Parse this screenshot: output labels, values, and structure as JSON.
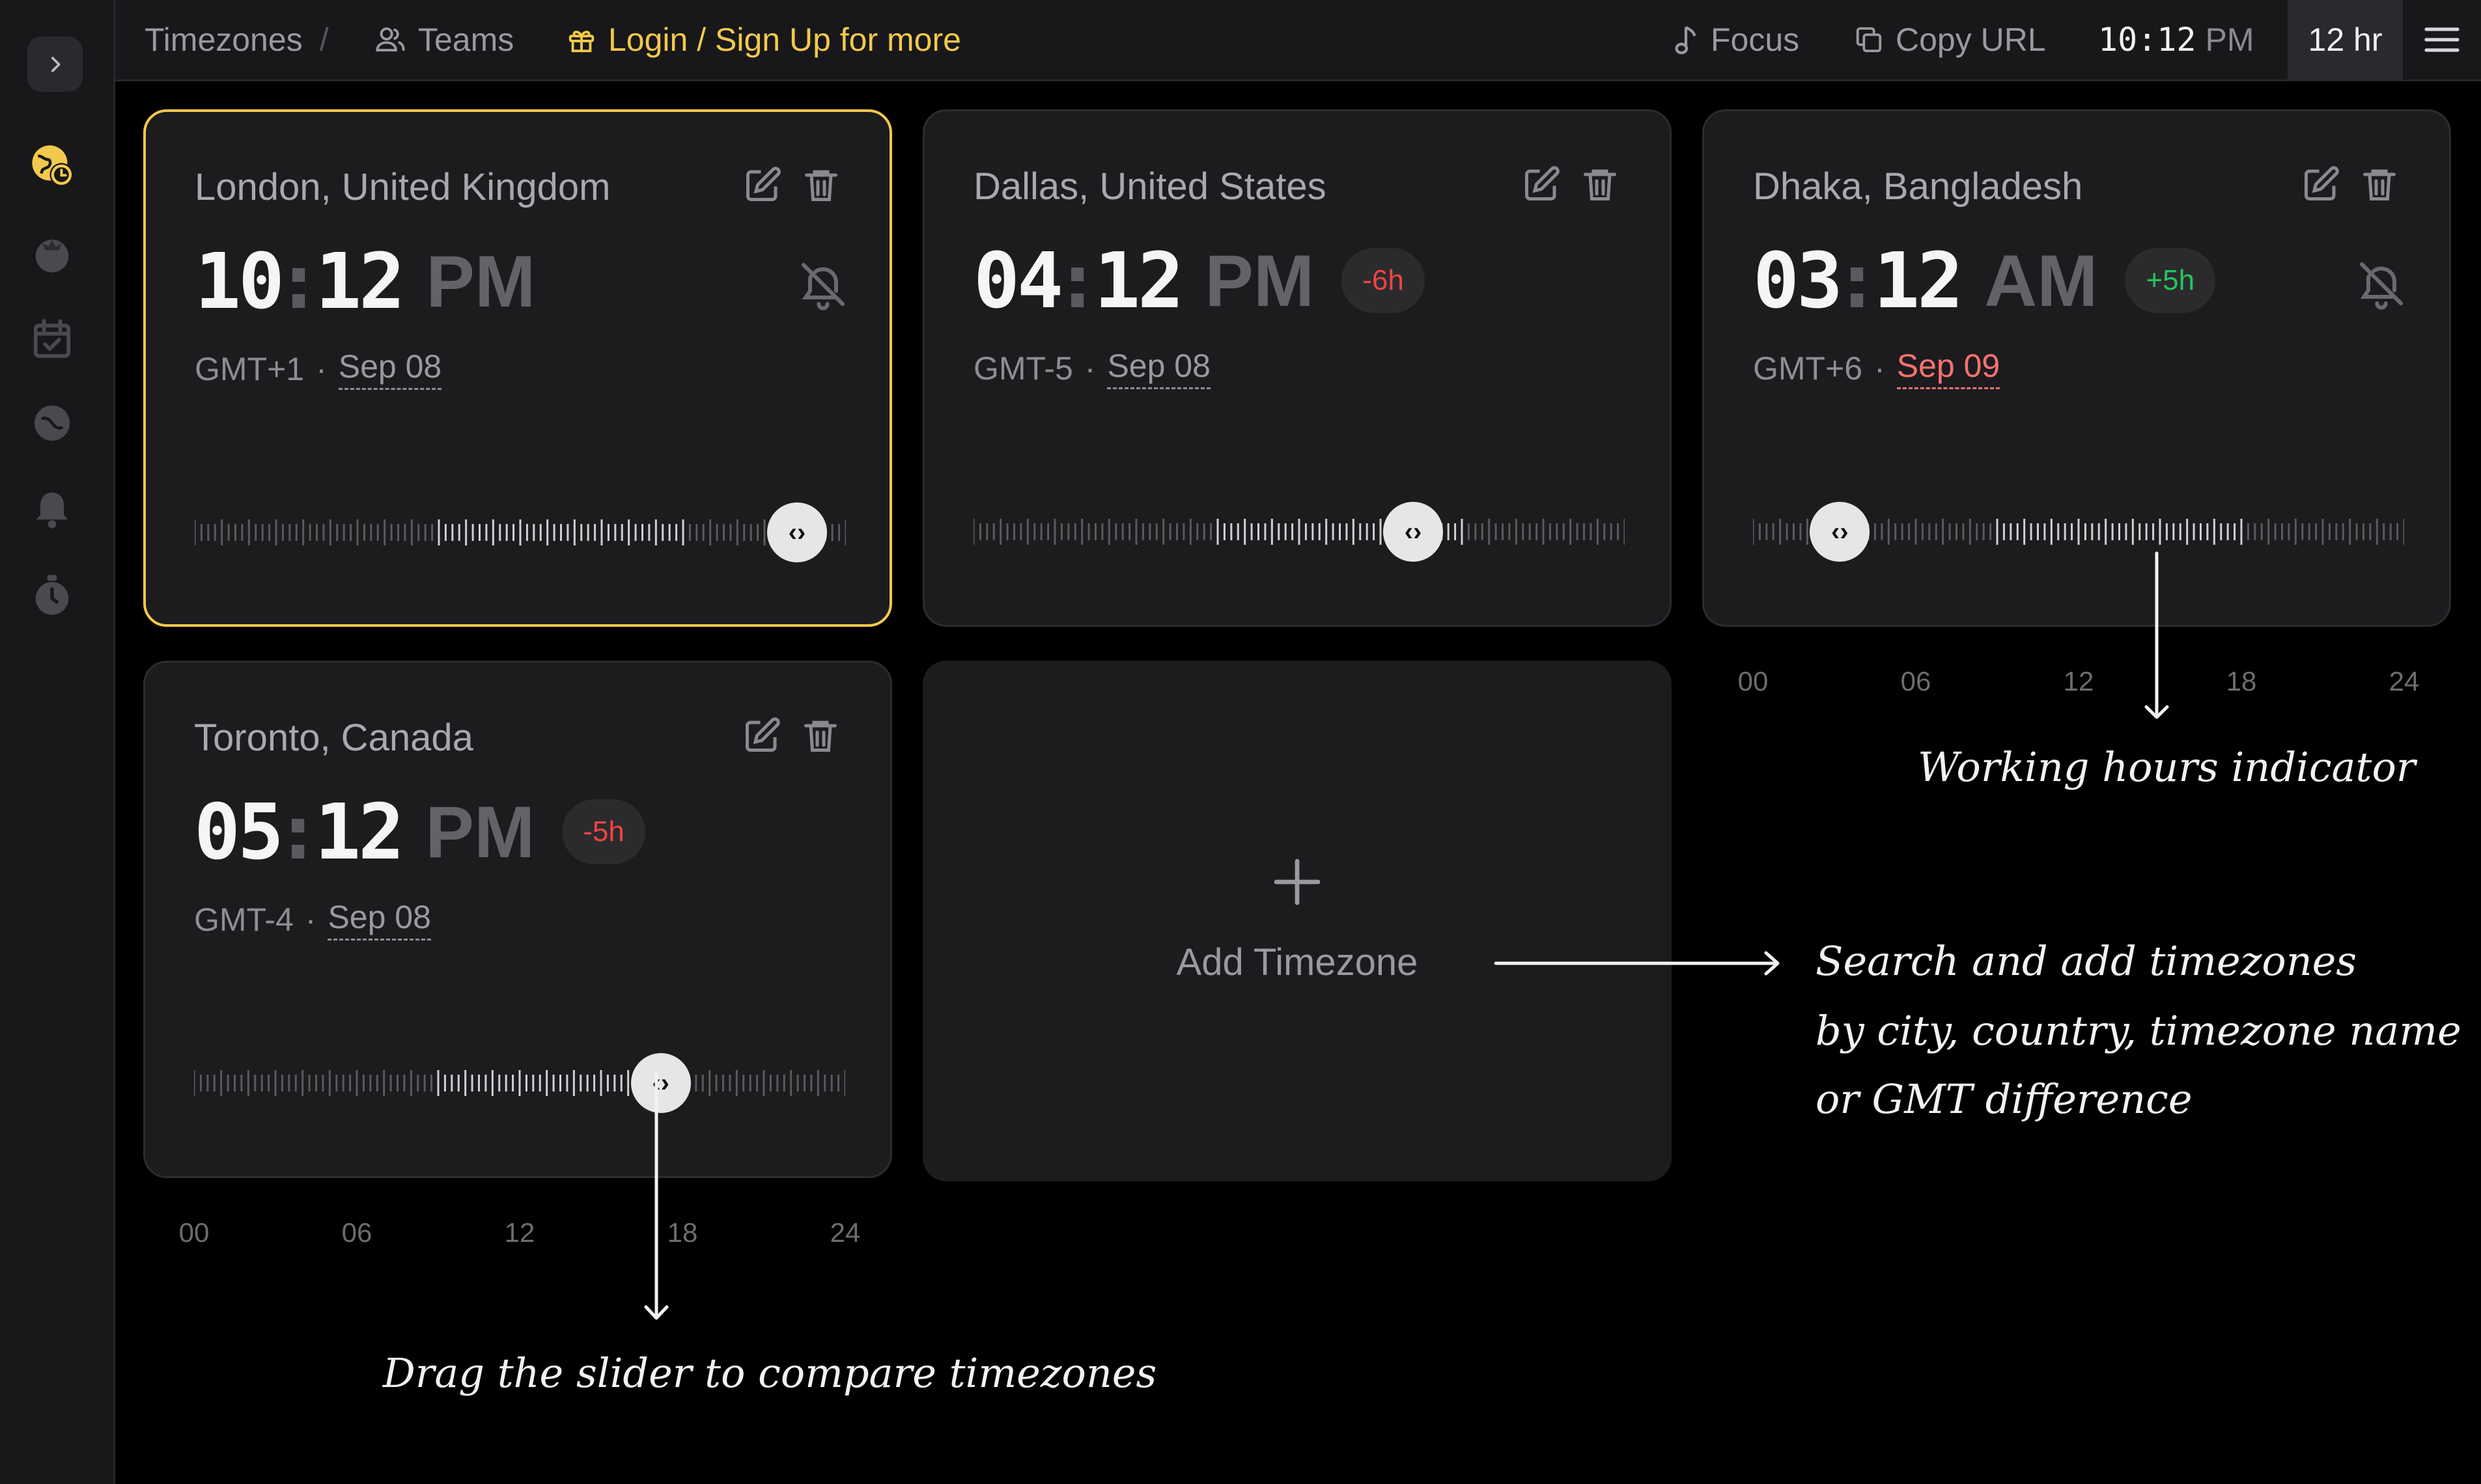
{
  "topbar": {
    "breadcrumb_root": "Timezones",
    "breadcrumb_sep": "/",
    "teams_label": "Teams",
    "login_label": "Login / Sign Up for more",
    "focus_label": "Focus",
    "copy_url_label": "Copy URL",
    "current_time": "10:12",
    "current_ampm": "PM",
    "hour_format": "12 hr",
    "login_color": "#f2c94c"
  },
  "cards": [
    {
      "city": "London, United Kingdom",
      "hours": "10",
      "minutes": "12",
      "ampm": "PM",
      "offset": "",
      "gmt": "GMT+1",
      "date": "Sep 08",
      "next_day": false,
      "muted": true,
      "active": true,
      "slider_value_hours": 22.2
    },
    {
      "city": "Dallas, United States",
      "hours": "04",
      "minutes": "12",
      "ampm": "PM",
      "offset": "-6h",
      "gmt": "GMT-5",
      "date": "Sep 08",
      "next_day": false,
      "muted": false,
      "active": false,
      "slider_value_hours": 16.2
    },
    {
      "city": "Dhaka, Bangladesh",
      "hours": "03",
      "minutes": "12",
      "ampm": "AM",
      "offset": "+5h",
      "gmt": "GMT+6",
      "date": "Sep 09",
      "next_day": true,
      "muted": true,
      "active": false,
      "slider_value_hours": 3.2
    },
    {
      "city": "Toronto, Canada",
      "hours": "05",
      "minutes": "12",
      "ampm": "PM",
      "offset": "-5h",
      "gmt": "GMT-4",
      "date": "Sep 08",
      "next_day": false,
      "muted": false,
      "active": false,
      "slider_value_hours": 17.2
    }
  ],
  "slider_hour_labels": [
    "00",
    "06",
    "12",
    "18",
    "24"
  ],
  "add_timezone_label": "Add Timezone",
  "notes": {
    "working_hours": "Working hours indicator",
    "search_line1": "Search and add timezones",
    "search_line2": "by city, country, timezone name",
    "search_line3": "or GMT difference",
    "drag_slider": "Drag the slider to compare timezones"
  },
  "sidebar_icons": [
    "chevron-right-icon",
    "timezones-clock-icon",
    "tomato-icon",
    "calendar-check-icon",
    "moon-clock-icon",
    "bell-icon",
    "stopwatch-icon"
  ],
  "colors": {
    "accent": "#f2c94c",
    "negative": "#ef4444",
    "positive": "#22c55e"
  }
}
